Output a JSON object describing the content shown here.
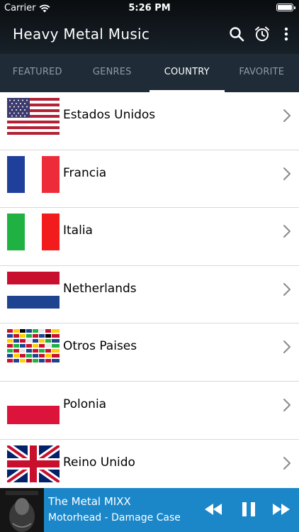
{
  "status_bar": {
    "carrier": "Carrier",
    "time": "5:26 PM"
  },
  "app_bar": {
    "title": "Heavy Metal Music",
    "icons": [
      "search-icon",
      "alarm-clock-icon",
      "more-vertical-icon"
    ]
  },
  "tabs": [
    {
      "label": "FEATURED",
      "active": false
    },
    {
      "label": "GENRES",
      "active": false
    },
    {
      "label": "COUNTRY",
      "active": true
    },
    {
      "label": "FAVORITE",
      "active": false
    }
  ],
  "countries": [
    {
      "label": "Estados Unidos",
      "flag": "usa-flag-icon"
    },
    {
      "label": "Francia",
      "flag": "france-flag-icon"
    },
    {
      "label": "Italia",
      "flag": "italy-flag-icon"
    },
    {
      "label": "Netherlands",
      "flag": "netherlands-flag-icon"
    },
    {
      "label": "Otros Paises",
      "flag": "world-flags-icon"
    },
    {
      "label": "Polonia",
      "flag": "poland-flag-icon"
    },
    {
      "label": "Reino Unido",
      "flag": "uk-flag-icon"
    }
  ],
  "player": {
    "station": "The Metal MIXX",
    "now_playing": "Motorhead - Damage Case",
    "controls": [
      "rewind-icon",
      "pause-icon",
      "fast-forward-icon"
    ]
  },
  "colors": {
    "header_bg": "#182129",
    "tab_bar_bg": "#1f2c37",
    "tab_inactive": "#8e9aa5",
    "tab_active": "#ffffff",
    "player_bg": "#1b87c9",
    "chevron": "#8a8a8a"
  }
}
